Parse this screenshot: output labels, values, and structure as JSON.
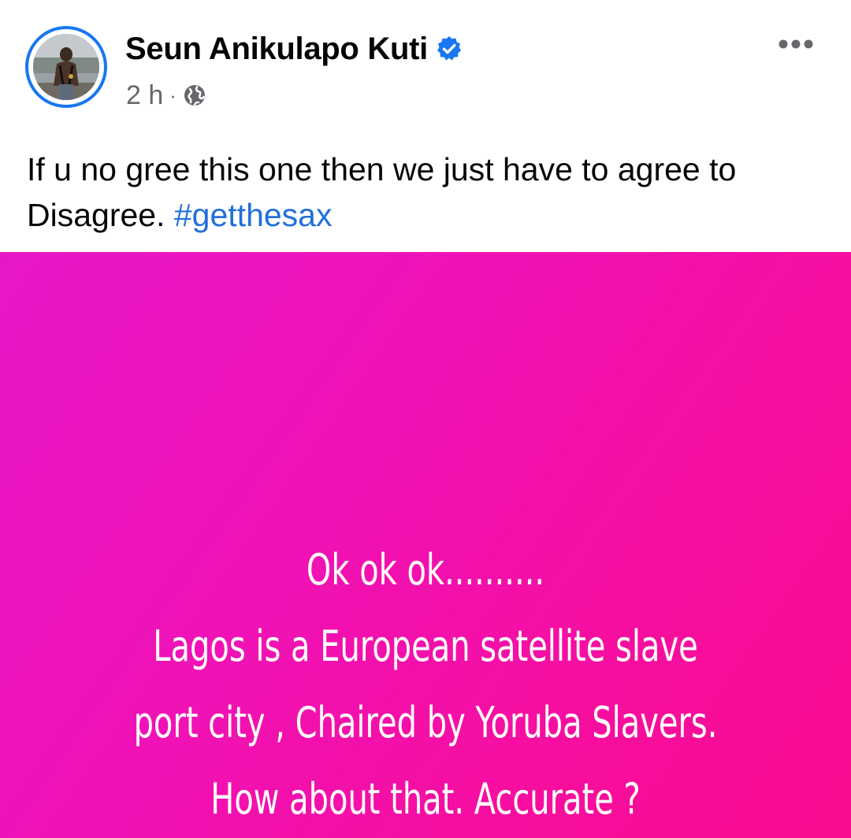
{
  "post": {
    "author": {
      "name": "Seun Anikulapo Kuti",
      "verified": true,
      "avatar_alt": "profile photo"
    },
    "timestamp": "2 h",
    "separator": "·",
    "audience_icon": "globe-icon",
    "more_icon": "more-options-icon",
    "caption": {
      "text": "If u no gree this one then we just have to agree to Disagree. ",
      "hashtag": "#getthesax"
    },
    "text_post": {
      "background_colors": [
        "#e717c8",
        "#fb0b8f"
      ],
      "text_color": "#ffffff",
      "lines": [
        "Ok ok ok..........",
        "Lagos is a European satellite slave",
        "port city , Chaired by Yoruba Slavers.",
        "How about that. Accurate ?"
      ]
    }
  },
  "colors": {
    "accent": "#1877f2",
    "hashtag": "#216fdb",
    "meta_text": "#65676b",
    "primary_text": "#050505"
  }
}
